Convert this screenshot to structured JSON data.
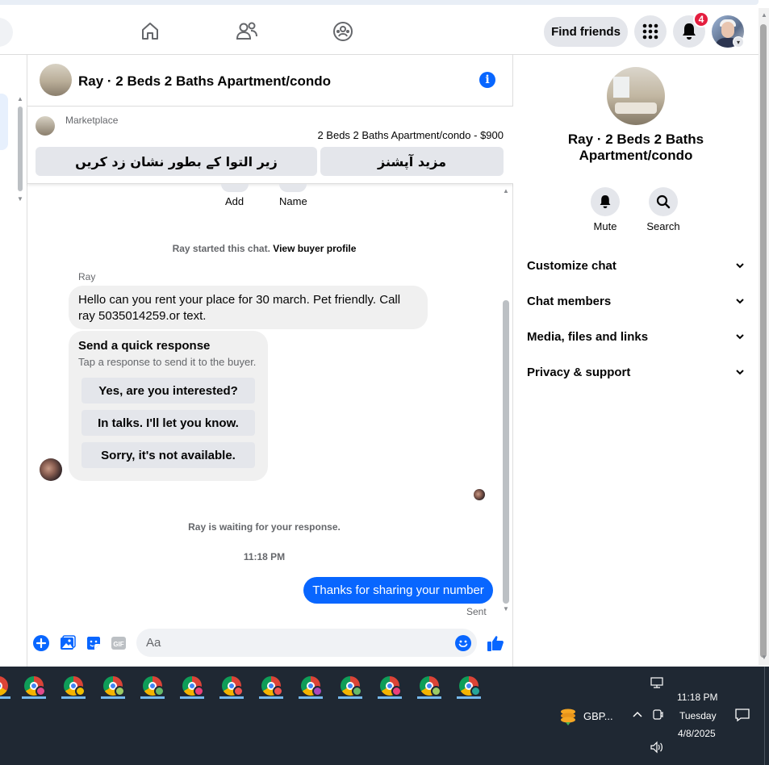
{
  "header": {
    "find_friends": "Find friends",
    "notifications_count": "4",
    "nav_icons": [
      "home-icon",
      "friends-icon",
      "groups-icon"
    ]
  },
  "chat": {
    "title": "Ray · 2 Beds 2 Baths Apartment/condo",
    "marketplace_label": "Marketplace",
    "listing": "2 Beds 2 Baths Apartment/condo - $900",
    "report_button": "زیر التوا کے بطور نشان زد کریں",
    "more_options_button": "مزید آپشنز",
    "top_actions": [
      "Add",
      "Name"
    ],
    "started_text": "Ray started this chat.",
    "view_buyer_profile": "View buyer profile",
    "sender_name": "Ray",
    "incoming_message": "Hello can you rent your place for 30 march. Pet friendly. Call ray 5035014259.or text.",
    "quick_response_title": "Send a quick response",
    "quick_response_subtitle": "Tap a response to send it to the buyer.",
    "quick_responses": [
      "Yes, are you interested?",
      "In talks. I'll let you know.",
      "Sorry, it's not available."
    ],
    "waiting_text": "Ray is waiting for your response.",
    "timestamp": "11:18 PM",
    "outgoing_message": "Thanks for sharing your number",
    "sent_status": "Sent",
    "composer_placeholder": "Aa",
    "composer_icons": [
      "plus-icon",
      "photo-icon",
      "sticker-icon",
      "gif-icon",
      "emoji-icon",
      "like-icon"
    ]
  },
  "info_panel": {
    "name": "Ray · 2 Beds 2 Baths Apartment/condo",
    "actions": [
      "Mute",
      "Search"
    ],
    "sections": [
      "Customize chat",
      "Chat members",
      "Media, files and links",
      "Privacy & support"
    ]
  },
  "taskbar": {
    "gbp_label": "GBP...",
    "time": "11:18 PM",
    "day": "Tuesday",
    "date": "4/8/2025"
  },
  "colors": {
    "accent": "#0866ff",
    "badge": "#e41e3f",
    "taskbar": "#1f2833"
  }
}
